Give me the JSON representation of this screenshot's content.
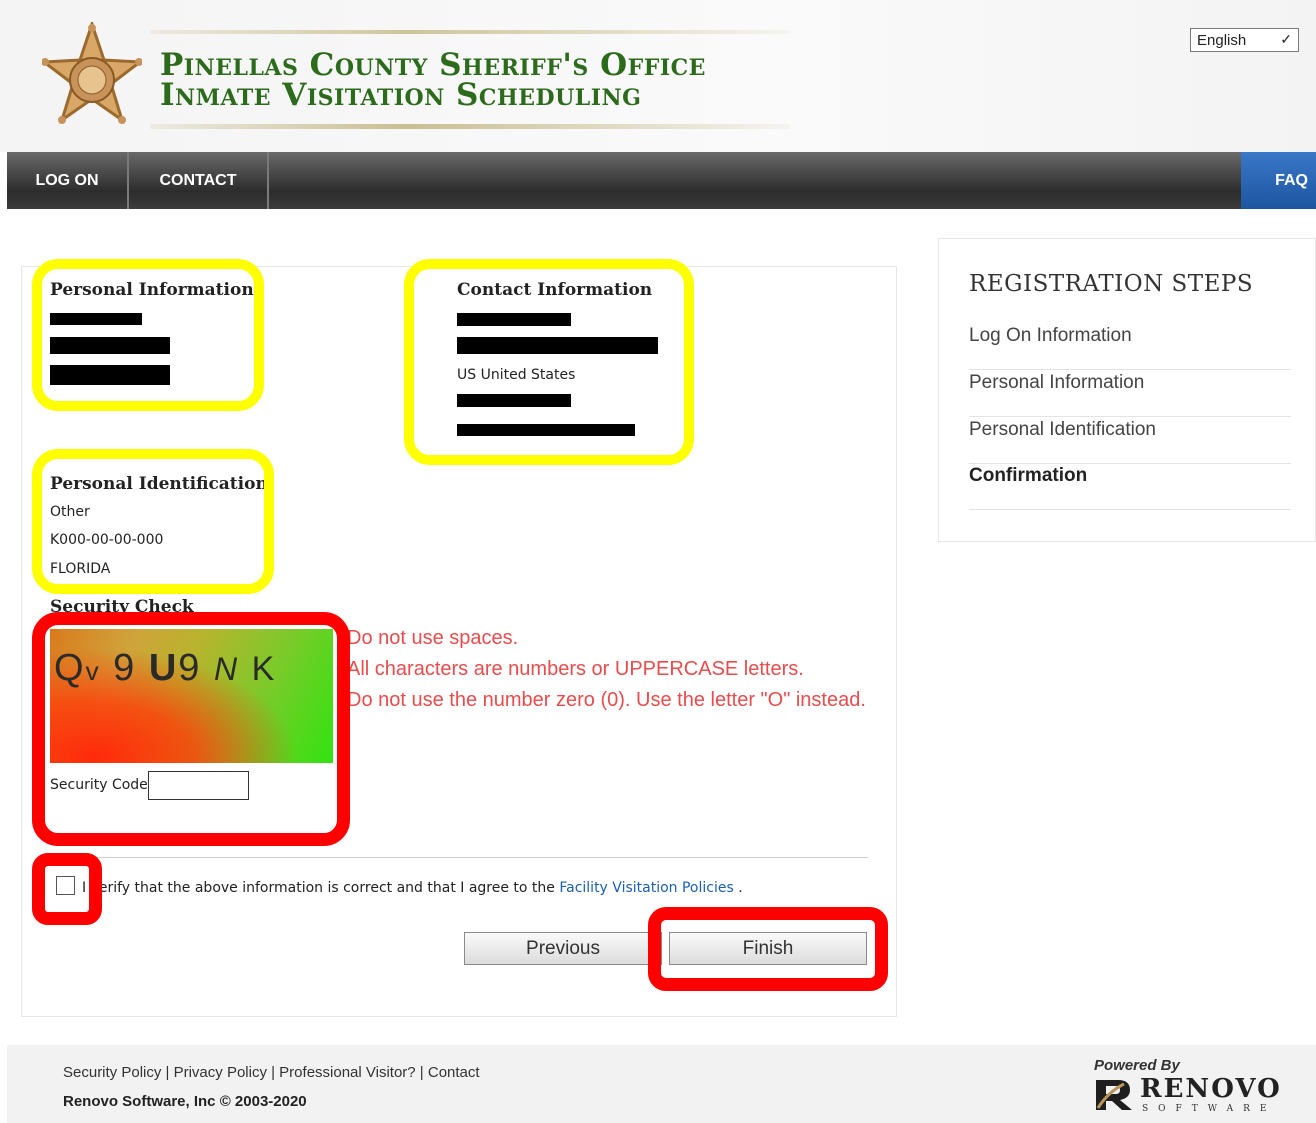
{
  "header": {
    "title_line1": "Pinellas County Sheriff's Office",
    "title_line2": "Inmate Visitation Scheduling",
    "language": "English"
  },
  "nav": {
    "items": [
      {
        "label": "LOG ON"
      },
      {
        "label": "CONTACT"
      }
    ],
    "faq": "FAQ"
  },
  "personal_information": {
    "title": "Personal Information"
  },
  "contact_information": {
    "title": "Contact Information",
    "country": "US United States"
  },
  "personal_identification": {
    "title": "Personal Identification",
    "type": "Other",
    "number": "K000-00-00-000",
    "state": "FLORIDA"
  },
  "security_check": {
    "title": "Security Check",
    "captcha": [
      "Q",
      "v",
      "9",
      "U",
      "9",
      "N",
      "K"
    ],
    "hints": [
      "Do not use spaces.",
      "All characters are numbers or UPPERCASE letters.",
      "Do not use the number zero (0). Use the letter \"O\" instead."
    ],
    "code_label": "Security Code",
    "code_value": ""
  },
  "verify": {
    "text_before": "I verify that the above information is correct and that I agree to the",
    "link": "Facility Visitation Policies",
    "text_after": " .",
    "checked": false
  },
  "buttons": {
    "previous": "Previous",
    "finish": "Finish"
  },
  "registration_steps": {
    "title": "REGISTRATION STEPS",
    "items": [
      {
        "label": "Log On Information",
        "active": false
      },
      {
        "label": "Personal Information",
        "active": false
      },
      {
        "label": "Personal Identification",
        "active": false
      },
      {
        "label": "Confirmation",
        "active": true
      }
    ]
  },
  "footer": {
    "links": "Security Policy | Privacy Policy | Professional Visitor? | Contact",
    "copyright": "Renovo Software, Inc © 2003-2020",
    "powered_by": "Powered By",
    "brand": "RENOVO",
    "brand_sub": "SOFTWARE"
  },
  "colors": {
    "brand_green": "#2d6b1c",
    "faq_blue": "#1d55a0",
    "hint_red": "#e84c4c",
    "highlight_yellow": "#ffff00",
    "highlight_red": "#ff0000",
    "link_blue": "#1a5fb4"
  },
  "icons": {
    "logo": "sheriff-star-badge-icon",
    "dropdown": "chevron-down-icon",
    "renovo_logo": "renovo-logo-icon"
  }
}
